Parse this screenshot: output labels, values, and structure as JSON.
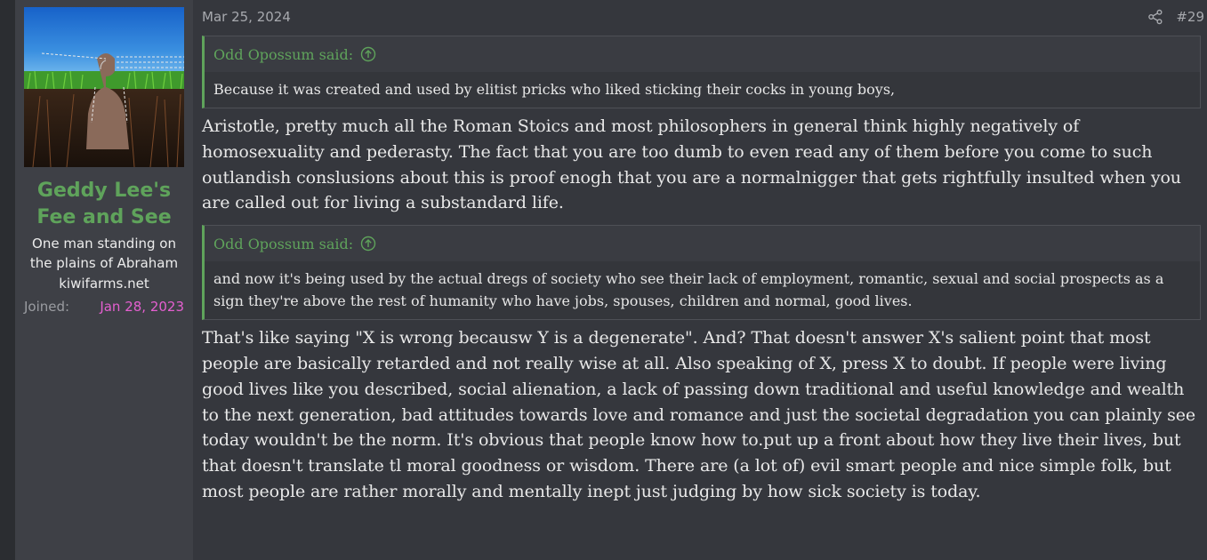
{
  "post": {
    "date": "Mar 25, 2024",
    "number": "#29",
    "share_icon": "share-icon"
  },
  "user": {
    "name": "Geddy Lee's Fee and See",
    "title": "One man standing on the plains of Abraham",
    "site": "kiwifarms.net",
    "joined_label": "Joined:",
    "joined_date": "Jan 28, 2023"
  },
  "quotes": [
    {
      "author": "Odd Opossum said:",
      "text": "Because it was created and used by elitist pricks who liked sticking their cocks in young boys,"
    },
    {
      "author": "Odd Opossum said:",
      "text": "and now it's being used by the actual dregs of society who see their lack of employment, romantic, sexual and social prospects as a sign they're above the rest of humanity who have jobs, spouses, children and normal, good lives."
    }
  ],
  "paragraphs": [
    "Aristotle, pretty much all the Roman Stoics and most philosophers in general think highly negatively of homosexuality and pederasty. The fact that you are too dumb to even read any of them before you come to such outlandish conslusions about this is proof enogh that you are a normalnigger that gets rightfully insulted when you are called out for living a substandard life.",
    "That's like saying \"X is wrong becausw Y is a degenerate\". And? That doesn't answer X's salient point that most people are basically retarded and not really wise at all. Also speaking of X, press X to doubt. If people were living good lives like you described, social alienation, a lack of passing down traditional and useful knowledge and wealth to the next generation, bad attitudes towards love and romance and just the societal degradation you can plainly see today wouldn't be the norm. It's obvious that people know how to.put up a front about how they live their lives, but that doesn't translate tl moral goodness or wisdom. There are (a lot of) evil smart people and nice simple folk, but most people are rather morally and mentally inept just judging by how sick society is today."
  ],
  "colors": {
    "accent": "#5fa35b",
    "joined_date": "#e45fd0",
    "background": "#35373d",
    "sidebar": "#3e4046"
  }
}
